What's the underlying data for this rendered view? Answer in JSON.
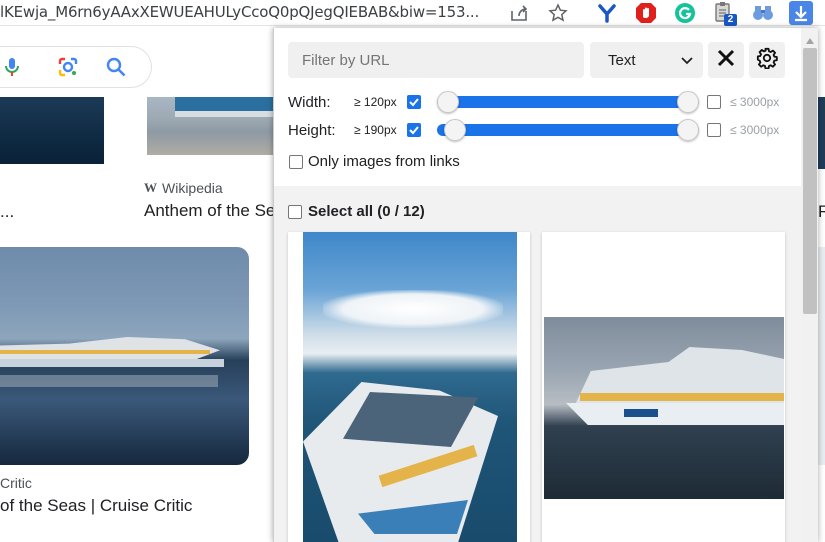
{
  "browser": {
    "url_fragment": "lKEwja_M6rn6yAAxXEWUEAHULyCcoQ0pQJegQIEBAB&biw=153...",
    "extension_badge": "2"
  },
  "background_page": {
    "result1_source": "Wikipedia",
    "result1_title": "Anthem of the Se",
    "left_ellipsis": "...",
    "result2_source": "Critic",
    "result2_title": "of the Seas | Cruise Critic",
    "right_edge_text": "R"
  },
  "popup": {
    "filter_placeholder": "Filter by URL",
    "type_select_value": "Text",
    "width": {
      "label": "Width:",
      "min_label": "≥ 120px",
      "max_label": "≤ 3000px",
      "min_checked": true,
      "max_checked": false
    },
    "height": {
      "label": "Height:",
      "min_label": "≥ 190px",
      "max_label": "≤ 3000px",
      "min_checked": true,
      "max_checked": false
    },
    "links_only_label": "Only images from links",
    "select_all_label": "Select all (0 / 12)"
  },
  "colors": {
    "accent": "#1a73e8",
    "panel_bg": "#f2f2f2",
    "control_bg": "#f0f0f0"
  }
}
